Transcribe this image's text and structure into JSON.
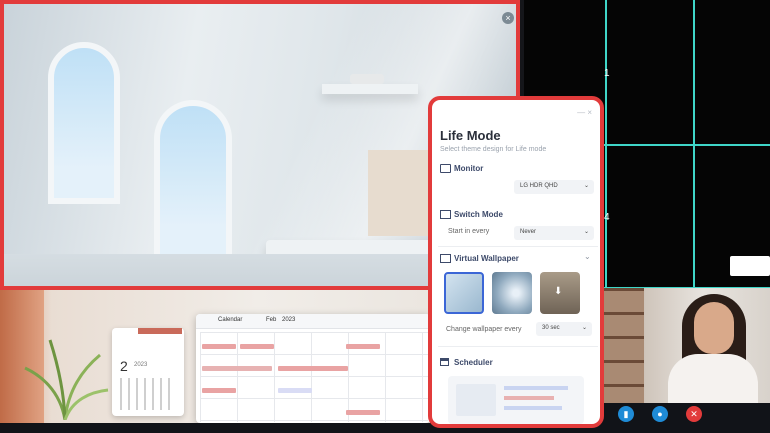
{
  "panel": {
    "title": "Life Mode",
    "subtitle": "Select theme design for Life mode",
    "monitor": {
      "label": "Monitor",
      "value": "LG HDR QHD"
    },
    "switch_mode": {
      "label": "Switch Mode",
      "start_label": "Start in every",
      "start_value": "Never"
    },
    "virtual_wallpaper": {
      "label": "Virtual Wallpaper",
      "change_label": "Change wallpaper every",
      "change_value": "30 sec"
    },
    "scheduler": {
      "label": "Scheduler"
    }
  },
  "grid": {
    "cell_label_1": "1",
    "cell_label_4": "4"
  },
  "desk_calendar": {
    "day": "2",
    "year": "2023"
  },
  "calendar_app": {
    "title": "Calendar",
    "month": "Feb",
    "year": "2023"
  },
  "colors": {
    "accent_red": "#e23b3b",
    "grid_line": "#3fd6c8",
    "call_blue": "#1f8bd6",
    "call_red": "#e23b3b"
  },
  "icons": [
    "close-icon",
    "monitor-icon",
    "switch-mode-icon",
    "wallpaper-icon",
    "calendar-icon",
    "chevron-down-icon",
    "signal-icon",
    "chat-icon",
    "end-call-icon"
  ]
}
